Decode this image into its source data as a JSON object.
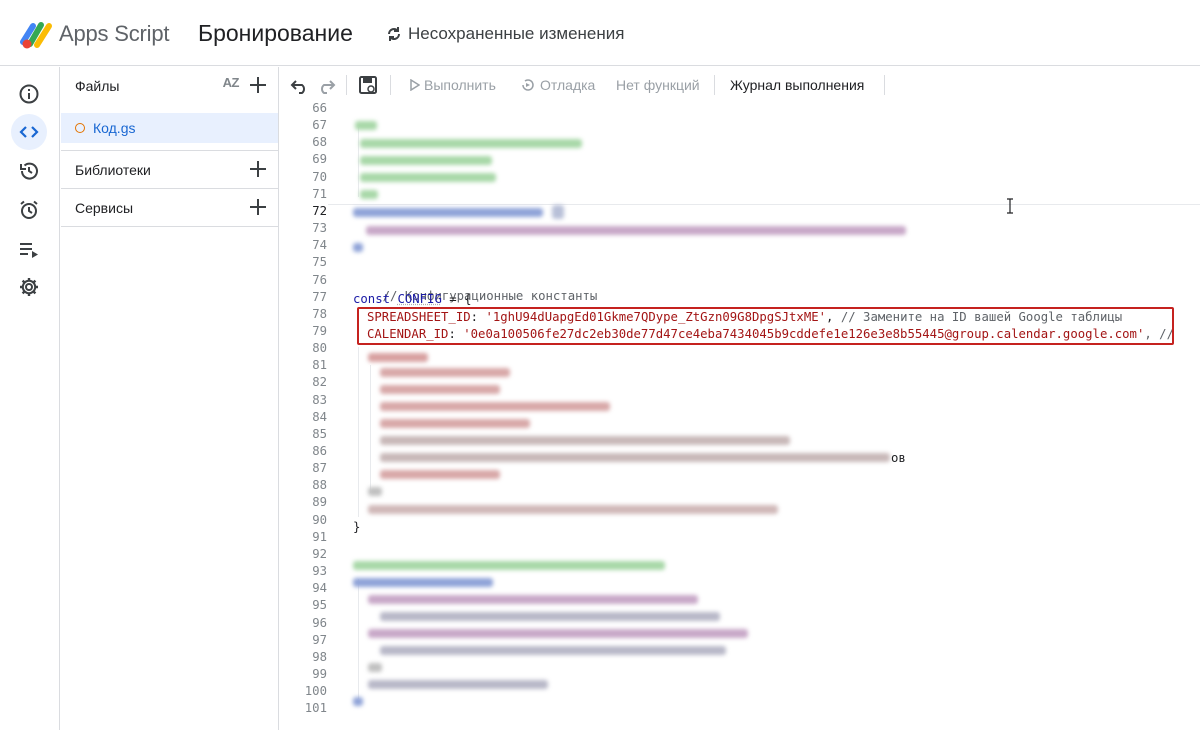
{
  "header": {
    "app_name": "Apps Script",
    "project_name": "Бронирование",
    "save_status": "Несохраненные изменения"
  },
  "rail": {
    "items": [
      "info-icon",
      "code-icon",
      "history-icon",
      "alarm-icon",
      "executions-icon",
      "settings-icon"
    ],
    "active": "code-icon"
  },
  "files_panel": {
    "files_title": "Файлы",
    "sort_label": "AZ",
    "file_name": "Код.gs",
    "libraries_title": "Библиотеки",
    "services_title": "Сервисы"
  },
  "toolbar": {
    "run_label": "Выполнить",
    "debug_label": "Отладка",
    "no_functions_label": "Нет функций",
    "log_label": "Журнал выполнения"
  },
  "editor": {
    "current_line": 72,
    "line_numbers": [
      "66",
      "67",
      "68",
      "69",
      "70",
      "71",
      "72",
      "73",
      "74",
      "75",
      "76",
      "77",
      "78",
      "79",
      "80",
      "81",
      "82",
      "83",
      "84",
      "85",
      "86",
      "87",
      "88",
      "89",
      "90",
      "91",
      "92",
      "93",
      "94",
      "95",
      "96",
      "97",
      "98",
      "99",
      "100",
      "101"
    ],
    "comment_config": "// Конфигурационные константы",
    "const_kw": "const",
    "config_name": "CONFIG",
    "config_open": " = {",
    "spreadsheet_key": "SPREADSHEET_ID",
    "spreadsheet_value": "'1ghU94dUapgEd01Gkme7QDype_ZtGzn09G8DpgSJtxME'",
    "spreadsheet_comment": "// Замените на ID вашей Google таблицы",
    "calendar_key": "CALENDAR_ID",
    "calendar_value": "'0e0a100506fe27dc2eb30de77d47ce4eba7434045b9cddefe1e126e3e8b55445@group.calendar.google.com'",
    "calendar_tail": ", //",
    "line86_tail": "ов",
    "close_brace": "}",
    "colors": {
      "highlight_border": "#c5221f",
      "keyword": "#1a1aa6",
      "string": "#a31515",
      "accent": "#1967d2"
    }
  }
}
